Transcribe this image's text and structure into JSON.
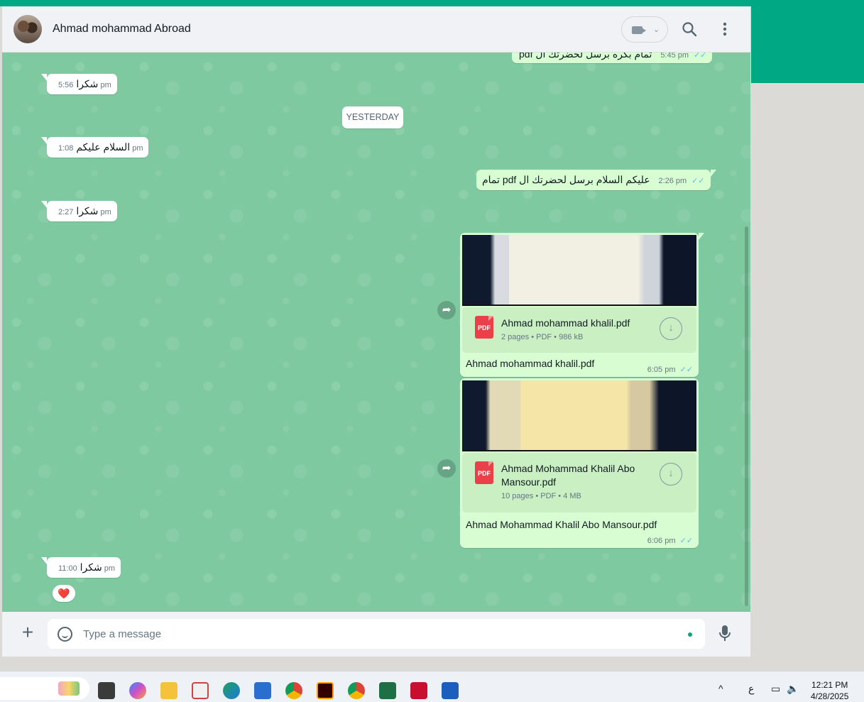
{
  "header": {
    "contact_name": "Ahmad mohammad Abroad"
  },
  "messages": {
    "top_out": {
      "text": "تمام بكره برسل لحضرتك ال pdf",
      "time": "5:45 pm"
    },
    "m1": {
      "text": "شكرا",
      "time": "5:56 pm"
    },
    "date_divider": "YESTERDAY",
    "m2": {
      "text": "السلام عليكم",
      "time": "1:08 pm"
    },
    "m3": {
      "text": "عليكم السلام برسل لحضرتك ال pdf تمام",
      "time": "2:26 pm"
    },
    "m4": {
      "text": "شكرا",
      "time": "2:27 pm"
    },
    "doc1": {
      "file_name": "Ahmad mohammad khalil.pdf",
      "meta": "2 pages • PDF • 986 kB",
      "caption": "Ahmad mohammad khalil.pdf",
      "time": "6:05 pm",
      "icon_label": "PDF"
    },
    "doc2": {
      "file_name": "Ahmad Mohammad Khalil Abo Mansour.pdf",
      "meta": "10 pages • PDF • 4 MB",
      "caption": "Ahmad Mohammad Khalil Abo Mansour.pdf",
      "time": "6:06 pm",
      "icon_label": "PDF"
    },
    "m5": {
      "text": "شكرا",
      "time": "11:00 pm",
      "reaction": "❤️"
    }
  },
  "composer": {
    "placeholder": "Type a message"
  },
  "taskbar": {
    "lang": "ع",
    "time": "12:21 PM",
    "date": "4/28/2025"
  },
  "colors": {
    "accent": "#00a884",
    "outgoing_bubble": "#d9fdd3",
    "chat_bg": "#7fc9a1",
    "read_ticks": "#53bdeb"
  }
}
